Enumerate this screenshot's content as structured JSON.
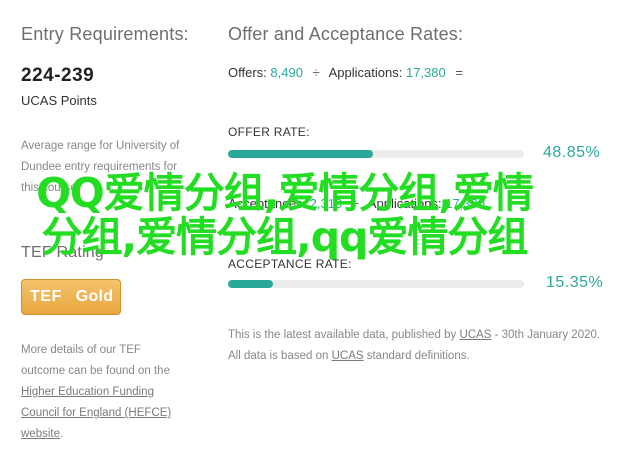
{
  "left": {
    "entry_title": "Entry Requirements:",
    "points_value": "224-239",
    "points_label": "UCAS Points",
    "avg_text": "Average range for University of Dundee entry requirements for this course.",
    "tef_title": "TEF Rating",
    "tef_badge": {
      "tef": "TEF",
      "rating": "Gold"
    },
    "details": {
      "line1": "More details of our TEF",
      "line2": "outcome can be found on the",
      "link1": "Higher Education Funding",
      "link2": "Council for England (HEFCE)",
      "link3": "website",
      "end": "."
    }
  },
  "right": {
    "offer_title": "Offer and Acceptance Rates:",
    "offers_label": "Offers:",
    "offers_value": "8,490",
    "op_divide": "÷",
    "applications_label": "Applications:",
    "applications_value": "17,380",
    "op_equals": "=",
    "offer_rate": {
      "label": "OFFER RATE:",
      "percent_text": "48.85%",
      "fraction": 0.4885
    },
    "acceptances_label": "Acceptances:",
    "acceptances_value": "2,310",
    "acceptance_rate": {
      "label": "ACCEPTANCE RATE:",
      "percent_text": "15.35%",
      "fraction": 0.1535
    },
    "footer": {
      "text1": "This is the latest available data, published by",
      "link1": "UCAS",
      "text2": " - 30th January 2020. All data is based on",
      "link2": "UCAS",
      "text3": " standard definitions."
    }
  },
  "overlay_text": "QQ爱情分组,爱情分组,爱情分组,爱情分组,qq爱情分组",
  "colors": {
    "accent": "#2aa99b",
    "overlay": "#22dd22",
    "gold": "#e8a640"
  }
}
